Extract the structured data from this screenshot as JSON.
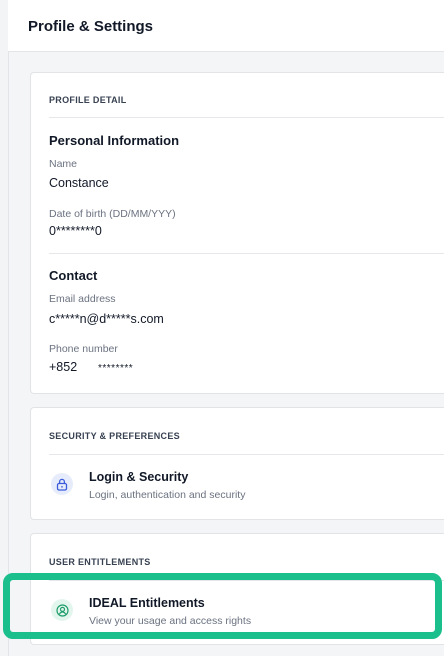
{
  "header": {
    "title": "Profile & Settings"
  },
  "profile": {
    "section_label": "PROFILE DETAIL",
    "personal": {
      "title": "Personal Information",
      "name_label": "Name",
      "name_value": "Constance",
      "dob_label": "Date of birth (DD/MM/YYY)",
      "dob_value": "0********0"
    },
    "contact": {
      "title": "Contact",
      "email_label": "Email address",
      "email_value": "c*****n@d*****s.com",
      "phone_label": "Phone number",
      "phone_code": "+852",
      "phone_value": "********"
    }
  },
  "security": {
    "section_label": "SECURITY & PREFERENCES",
    "login": {
      "title": "Login & Security",
      "subtitle": "Login, authentication and security",
      "icon": "lock-icon"
    }
  },
  "entitlements": {
    "section_label": "USER ENTITLEMENTS",
    "ideal": {
      "title": "IDEAL Entitlements",
      "subtitle": "View your usage and access rights",
      "icon": "user-badge-icon"
    }
  },
  "colors": {
    "highlight": "#1abf8c",
    "lock_icon_bg": "#e6ecfb",
    "lock_icon_fg": "#3b5bdb",
    "user_icon_bg": "#e3f6ee",
    "user_icon_fg": "#1f9d6b"
  }
}
